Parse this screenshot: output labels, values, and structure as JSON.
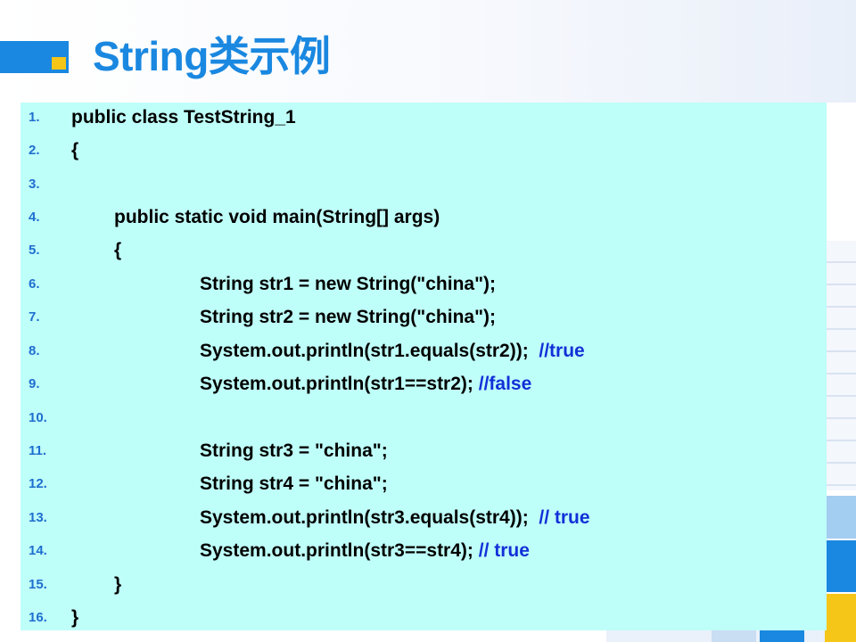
{
  "slide": {
    "title": "String类示例"
  },
  "code": {
    "lines": [
      {
        "num": "1.",
        "code": "public class TestString_1",
        "comment": ""
      },
      {
        "num": "2.",
        "code": "{",
        "comment": ""
      },
      {
        "num": "3.",
        "code": "",
        "comment": ""
      },
      {
        "num": "4.",
        "code": "public static void main(String[] args)",
        "comment": ""
      },
      {
        "num": "5.",
        "code": "{",
        "comment": ""
      },
      {
        "num": "6.",
        "code": "String str1 = new String(\"china\");",
        "comment": ""
      },
      {
        "num": "7.",
        "code": "String str2 = new String(\"china\");",
        "comment": ""
      },
      {
        "num": "8.",
        "code": "System.out.println(str1.equals(str2));  ",
        "comment": "//true"
      },
      {
        "num": "9.",
        "code": "System.out.println(str1==str2); ",
        "comment": "//false"
      },
      {
        "num": "10.",
        "code": "",
        "comment": ""
      },
      {
        "num": "11.",
        "code": "String str3 = \"china\";",
        "comment": ""
      },
      {
        "num": "12.",
        "code": "String str4 = \"china\";",
        "comment": ""
      },
      {
        "num": "13.",
        "code": "System.out.println(str3.equals(str4));  ",
        "comment": "// true"
      },
      {
        "num": "14.",
        "code": "System.out.println(str3==str4); ",
        "comment": "// true"
      },
      {
        "num": "15.",
        "code": "}",
        "comment": ""
      },
      {
        "num": "16.",
        "code": "}",
        "comment": ""
      }
    ]
  },
  "colors": {
    "accent_blue": "#1a88e0",
    "accent_yellow": "#f5c518",
    "code_background": "#bffff9",
    "line_number": "#1f6fd0",
    "comment": "#1230d8"
  }
}
